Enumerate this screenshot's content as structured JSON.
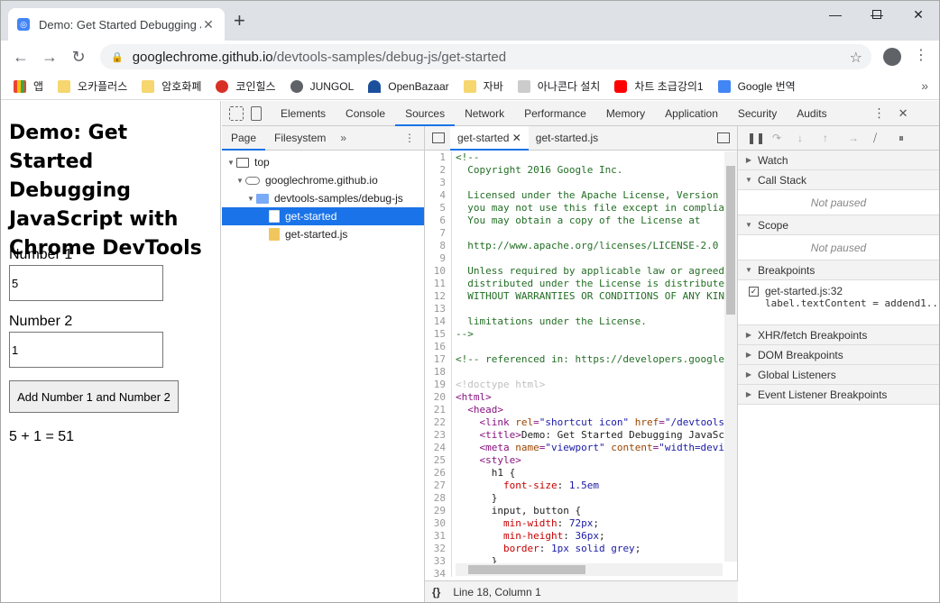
{
  "browser": {
    "tab_title": "Demo: Get Started Debugging J",
    "url_host": "googlechrome.github.io",
    "url_path": "/devtools-samples/debug-js/get-started"
  },
  "bookmarks": [
    "앱",
    "오카플러스",
    "암호화폐",
    "코인힐스",
    "JUNGOL",
    "OpenBazaar",
    "자바",
    "아나콘다 설치",
    "차트 초급강의1",
    "Google 번역"
  ],
  "page": {
    "heading": "Demo: Get Started Debugging JavaScript with Chrome DevTools",
    "label1": "Number 1",
    "value1": "5",
    "label2": "Number 2",
    "value2": "1",
    "button": "Add Number 1 and Number 2",
    "result": "5 + 1 = 51"
  },
  "devtools": {
    "tabs": [
      "Elements",
      "Console",
      "Sources",
      "Network",
      "Performance",
      "Memory",
      "Application",
      "Security",
      "Audits"
    ],
    "nav_tabs": [
      "Page",
      "Filesystem"
    ],
    "tree": [
      "top",
      "googlechrome.github.io",
      "devtools-samples/debug-js",
      "get-started",
      "get-started.js"
    ],
    "editor_tabs": [
      "get-started",
      "get-started.js"
    ],
    "status": "Line 18, Column 1",
    "status_icon": "{}",
    "sections": {
      "watch": "Watch",
      "call_stack": "Call Stack",
      "scope": "Scope",
      "breakpoints": "Breakpoints",
      "xhr": "XHR/fetch Breakpoints",
      "dom": "DOM Breakpoints",
      "global": "Global Listeners",
      "event": "Event Listener Breakpoints"
    },
    "not_paused": "Not paused",
    "breakpoint_file": "get-started.js:32",
    "breakpoint_code": "label.textContent = addend1..."
  },
  "colors": {
    "accent": "#1a73e8"
  }
}
